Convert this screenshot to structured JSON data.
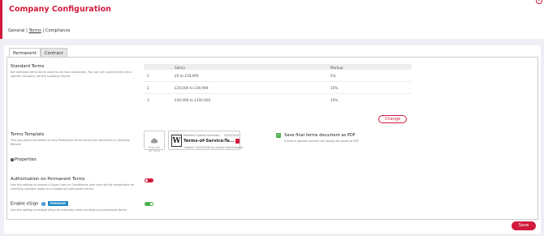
{
  "header": {
    "title": "Company Configuration",
    "breadcrumb": {
      "general": "General",
      "sep1": " | ",
      "terms": "Terms",
      "sep2": " | ",
      "compliance": "Compliance"
    },
    "close_icon": "×"
  },
  "tabs": [
    {
      "label": "Permanent"
    },
    {
      "label": "Contract"
    }
  ],
  "standard_terms": {
    "title": "Standard Terms",
    "description": "Set standard terms to be used for all new companies. You can set custom terms for a specific company via the company record.",
    "table": {
      "headers": [
        "",
        "Salary",
        "Markup"
      ],
      "rows": [
        {
          "index": "1",
          "salary": "£0 to £19,999",
          "markup": "5%"
        },
        {
          "index": "2",
          "salary": "£20,000 to £39,999",
          "markup": "10%"
        },
        {
          "index": "3",
          "salary": "£40,000 to £100,000",
          "markup": "20%"
        }
      ]
    },
    "change_label": "Change"
  },
  "terms_template": {
    "title": "Terms Template",
    "description": "This document will attach to any Permanent Terms email you send from a Company Record.",
    "drop_zone": {
      "line1": "Drop File",
      "line2": "(or click)"
    },
    "file": {
      "modified": "Modified: System Administr...",
      "modified_date": "05/03/2026",
      "name": "Terms-of-Service-Te...",
      "created": "Created: 20/03/2026 by System Administrator"
    },
    "save_pdf_label": "Save final terms document as PDF",
    "save_pdf_note": "A final or agreed contract will always be saved as PDF",
    "save_pdf_checked": true
  },
  "properties_label": "Properties",
  "authorisation": {
    "title": "Authorisation on Permanent Terms",
    "description": "Use this setting to choose a Super User or Compliance User who will be responsible for checking changes made to a company's permanent terms.",
    "enabled": false
  },
  "esign": {
    "title": "Enable eSign",
    "help_icon": "?",
    "badge": "PREMIUM",
    "description": "Use this setting to enable eSign functionality when sending out permanent terms.",
    "enabled": true
  },
  "save_label": "Save",
  "colors": {
    "brand": "#d11a3c",
    "success": "#4caf50",
    "premium": "#1e88c7"
  }
}
